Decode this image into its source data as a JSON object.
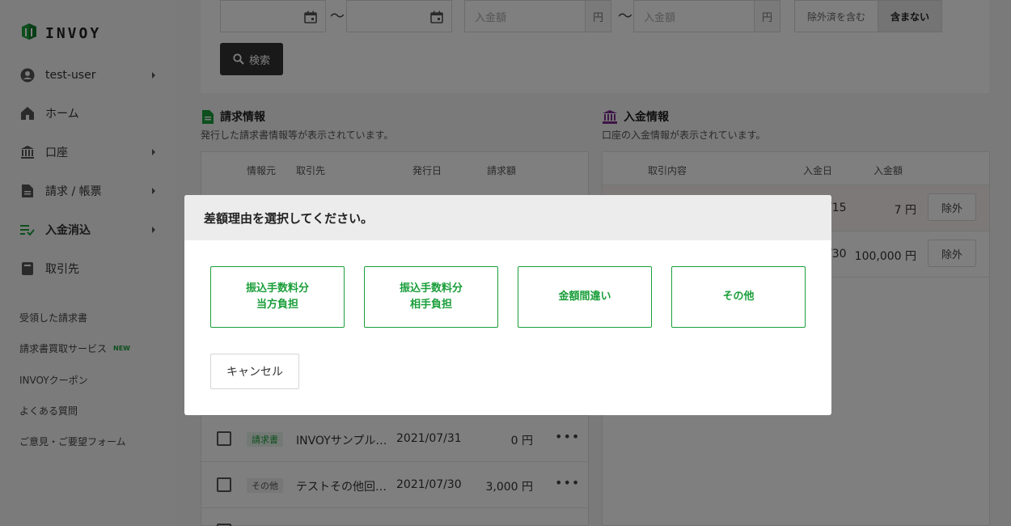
{
  "app": {
    "logo_text": "INVOY"
  },
  "sidebar": {
    "user": "test-user",
    "items": [
      {
        "label": "ホーム",
        "icon": "home-icon"
      },
      {
        "label": "口座",
        "icon": "bank-icon"
      },
      {
        "label": "請求 / 帳票",
        "icon": "document-icon"
      },
      {
        "label": "入金消込",
        "icon": "reconcile-icon"
      },
      {
        "label": "取引先",
        "icon": "contacts-icon"
      }
    ],
    "links": [
      "受領した請求書",
      "請求書買取サービス",
      "INVOYクーポン",
      "よくある質問",
      "ご意見・ご要望フォーム"
    ],
    "new_badge": "NEW"
  },
  "search": {
    "amount_placeholder_from": "入金額",
    "amount_placeholder_to": "入金額",
    "unit": "円",
    "tilde": "〜",
    "segment_include": "除外済を含む",
    "segment_exclude": "含まない",
    "search_button": "検索"
  },
  "invoice_section": {
    "title": "請求情報",
    "description": "発行した請求書情報等が表示されています。",
    "columns": [
      "情報元",
      "取引先",
      "発行日",
      "請求額"
    ],
    "rows": [
      {
        "tag": "請求書",
        "partner": "INVOYサンプル…",
        "date": "2021/07/31",
        "amount": "0 円"
      },
      {
        "tag": "その他",
        "partner": "テストその他回…",
        "date": "2021/07/30",
        "amount": "3,000 円"
      }
    ]
  },
  "deposit_section": {
    "title": "入金情報",
    "description": "口座の入金情報が表示されています。",
    "columns": [
      "取引内容",
      "入金日",
      "入金額"
    ],
    "rows": [
      {
        "date": "/15",
        "amount": "7 円",
        "action": "除外"
      },
      {
        "date": "/30",
        "amount": "100,000 円",
        "action": "除外"
      }
    ]
  },
  "modal": {
    "title": "差額理由を選択してください。",
    "options": [
      {
        "line1": "振込手数料分",
        "line2": "当方負担"
      },
      {
        "line1": "振込手数料分",
        "line2": "相手負担"
      },
      {
        "line1": "金額間違い",
        "line2": ""
      },
      {
        "line1": "その他",
        "line2": ""
      }
    ],
    "cancel": "キャンセル"
  },
  "colors": {
    "brand_green": "#1a9e3a",
    "reconcile_icon": "#1a9e3a",
    "bank_icon": "#7b2d8e",
    "doc_icon": "#1a9e3a"
  }
}
